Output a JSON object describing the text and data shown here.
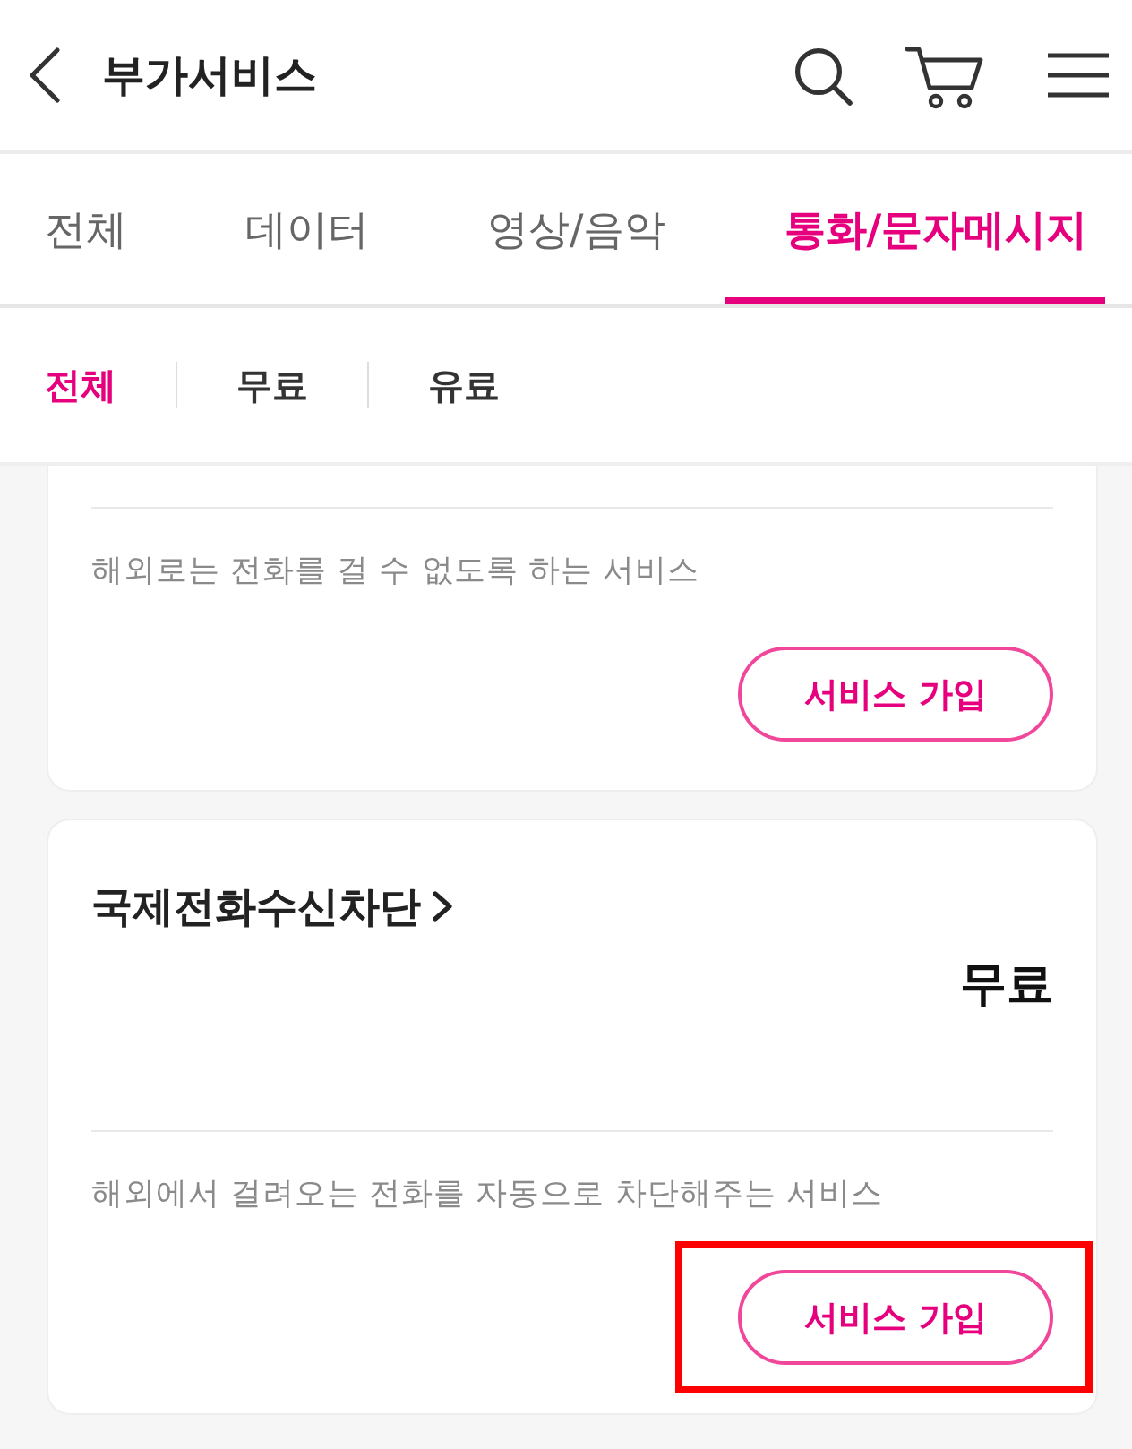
{
  "header": {
    "title": "부가서비스"
  },
  "tabs": [
    {
      "label": "전체",
      "selected": false
    },
    {
      "label": "데이터",
      "selected": false
    },
    {
      "label": "영상/음악",
      "selected": false
    },
    {
      "label": "통화/문자메시지",
      "selected": true
    }
  ],
  "filters": [
    {
      "label": "전체",
      "selected": true
    },
    {
      "label": "무료",
      "selected": false
    },
    {
      "label": "유료",
      "selected": false
    }
  ],
  "cards": [
    {
      "description": "해외로는 전화를 걸 수 없도록 하는 서비스",
      "button": {
        "label": "서비스 가입",
        "highlighted": false
      }
    },
    {
      "title": "국제전화수신차단",
      "price": "무료",
      "description": "해외에서 걸려오는 전화를 자동으로 차단해주는 서비스",
      "button": {
        "label": "서비스 가입",
        "highlighted": true
      }
    }
  ]
}
